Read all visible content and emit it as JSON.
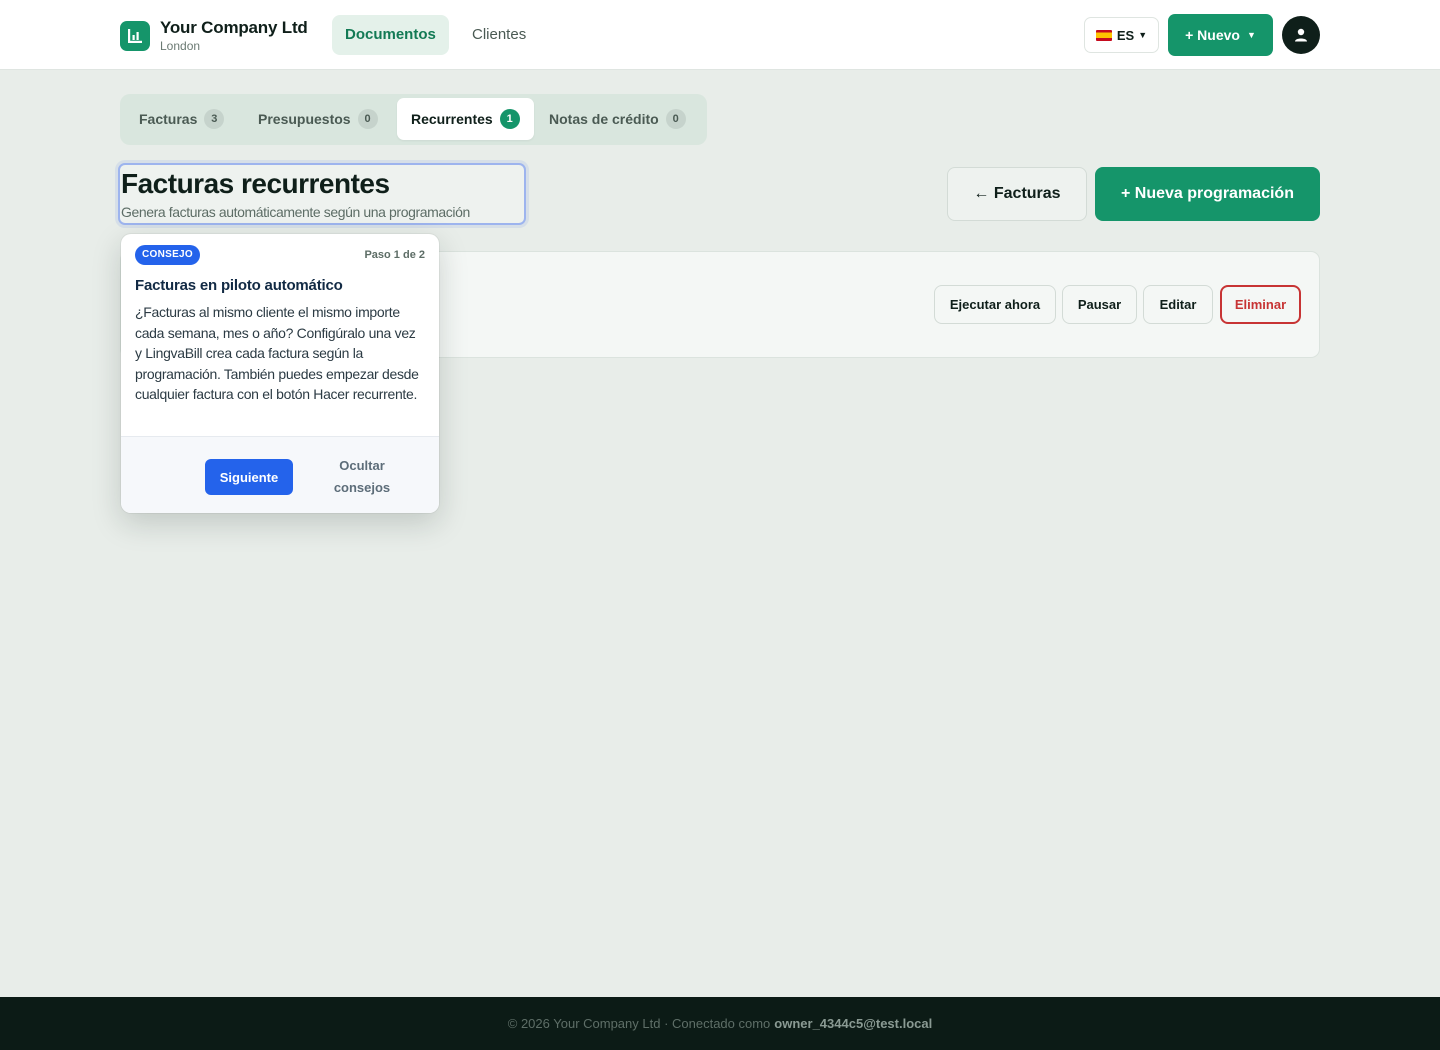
{
  "brand": {
    "name": "Your Company Ltd",
    "location": "London"
  },
  "nav": {
    "documents": "Documentos",
    "clients": "Clientes"
  },
  "header": {
    "lang": "ES",
    "new_label": "+ Nuevo"
  },
  "tabs": [
    {
      "label": "Facturas",
      "count": "3"
    },
    {
      "label": "Presupuestos",
      "count": "0"
    },
    {
      "label": "Recurrentes",
      "count": "1"
    },
    {
      "label": "Notas de crédito",
      "count": "0"
    }
  ],
  "page": {
    "title": "Facturas recurrentes",
    "subtitle": "Genera facturas automáticamente según una programación",
    "back_label": "← Facturas",
    "new_schedule_label": "+ Nueva programación"
  },
  "card_actions": {
    "run_now": "Ejecutar ahora",
    "pause": "Pausar",
    "edit": "Editar",
    "delete": "Eliminar"
  },
  "tip": {
    "badge": "CONSEJO",
    "step": "Paso 1 de 2",
    "title": "Facturas en piloto automático",
    "body": "¿Facturas al mismo cliente el mismo importe cada semana, mes o año? Configúralo una vez y LingvaBill crea cada factura según la programación. También puedes empezar desde cualquier factura con el botón Hacer recurrente.",
    "next": "Siguiente",
    "hide": "Ocultar consejos"
  },
  "footer": {
    "text": "© 2026 Your Company Ltd · Conectado como",
    "user": "owner_4344c5@test.local"
  },
  "colors": {
    "accent": "#15956a",
    "tip_blue": "#2463eb",
    "danger": "#c73434",
    "footer_bg": "#0c1b16"
  }
}
